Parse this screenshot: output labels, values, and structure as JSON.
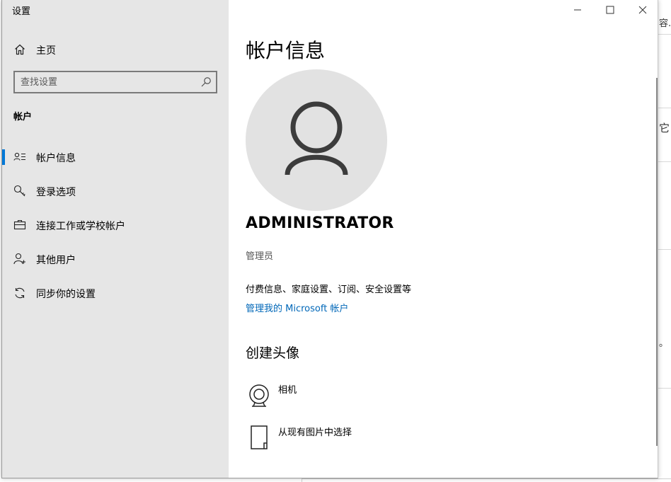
{
  "background": {
    "text_top": "容.",
    "text_mid": "它",
    "text_low": "。"
  },
  "window": {
    "title": "设置",
    "caption": {
      "minimize_icon": "minimize-icon",
      "maximize_icon": "maximize-icon",
      "close_icon": "close-icon"
    }
  },
  "sidebar": {
    "home_label": "主页",
    "search": {
      "placeholder": "查找设置",
      "value": ""
    },
    "section_header": "帐户",
    "items": [
      {
        "label": "帐户信息",
        "icon": "account-info-icon",
        "selected": true
      },
      {
        "label": "登录选项",
        "icon": "key-icon",
        "selected": false
      },
      {
        "label": "连接工作或学校帐户",
        "icon": "briefcase-icon",
        "selected": false
      },
      {
        "label": "其他用户",
        "icon": "add-person-icon",
        "selected": false
      },
      {
        "label": "同步你的设置",
        "icon": "sync-icon",
        "selected": false
      }
    ]
  },
  "main": {
    "title": "帐户信息",
    "user_name": "ADMINISTRATOR",
    "user_role": "管理员",
    "account_desc": "付费信息、家庭设置、订阅、安全设置等",
    "ms_link": "管理我的 Microsoft 帐户",
    "create_avatar_title": "创建头像",
    "options": [
      {
        "label": "相机",
        "icon": "webcam-icon"
      },
      {
        "label": "从现有图片中选择",
        "icon": "browse-picture-icon"
      }
    ]
  },
  "colors": {
    "accent": "#0078d7",
    "link": "#0067b8",
    "sidebar_bg": "#e6e6e6",
    "avatar_bg": "#e2e2e2"
  }
}
